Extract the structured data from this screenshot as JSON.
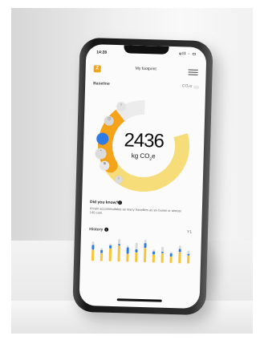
{
  "status": {
    "time": "14:28",
    "icons": "ull ◦ ▭"
  },
  "header": {
    "logo": "Z",
    "title": "My footprint"
  },
  "summary": {
    "baseline": "Baseline",
    "unit_option": "CO₂e",
    "value": "2436",
    "unit_main": "kg CO",
    "unit_sub": "2",
    "unit_tail": "e"
  },
  "fact": {
    "title": "Did you know?",
    "text": "A train accommodates as many travellers as six buses or almost 140 cars."
  },
  "history": {
    "title": "History",
    "control": "Y1"
  },
  "chart_data": {
    "type": "bar",
    "categories": [
      "",
      "",
      "",
      "",
      "",
      "",
      "",
      "",
      "",
      "",
      "",
      ""
    ],
    "series": [
      {
        "values": [
          7,
          5,
          8,
          10,
          5,
          6,
          9,
          5,
          6,
          4,
          7,
          5
        ]
      },
      {
        "values": [
          3,
          2,
          2,
          1,
          4,
          2,
          3,
          2,
          1,
          2,
          2,
          1
        ]
      },
      {
        "values": [
          2,
          1,
          1,
          3,
          1,
          4,
          2,
          1,
          3,
          1,
          2,
          2
        ]
      }
    ],
    "colors": [
      "#f8c537",
      "#2f7be5",
      "#d9d9d9"
    ]
  },
  "donut": {
    "segments": [
      {
        "value": 0.46,
        "color": "#f7dd7a"
      },
      {
        "value": 0.23,
        "color": "#f5a318"
      },
      {
        "value": 0.31,
        "color": "#ececec"
      }
    ]
  }
}
